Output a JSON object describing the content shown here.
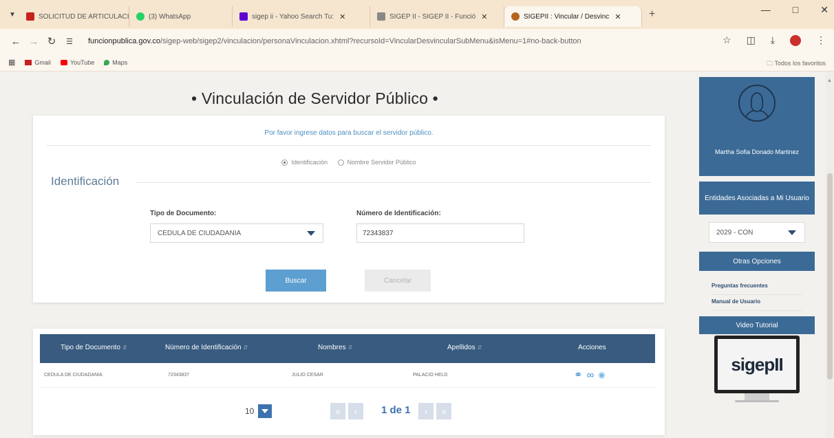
{
  "browser": {
    "tabs": [
      {
        "label": "SOLICITUD DE ARTICULACI",
        "favicon_color": "#c5221f",
        "active": false
      },
      {
        "label": "(3) WhatsApp",
        "favicon_color": "#25d366",
        "active": false
      },
      {
        "label": "sigep ii - Yahoo Search Tu:",
        "favicon_color": "#6001d2",
        "active": false
      },
      {
        "label": "SIGEP II - SIGEP II - Funció",
        "favicon_color": "#888888",
        "active": false
      },
      {
        "label": "SIGEPII : Vincular / Desvinc",
        "favicon_color": "#b5651d",
        "active": true
      }
    ],
    "url_host": "funcionpublica.gov.co",
    "url_path": "/sigep-web/sigep2/vinculacion/personaVinculacion.xhtml?recursoId=VincularDesvincularSubMenu&isMenu=1#no-back-button",
    "bookmarks": [
      {
        "label": "Gmail",
        "color": "#c5221f"
      },
      {
        "label": "YouTube",
        "color": "#ff0000"
      },
      {
        "label": "Maps",
        "color": "#34a853"
      }
    ],
    "bookmarks_right": "Todos los favoritos"
  },
  "page": {
    "title": "• Vinculación de Servidor Público •",
    "hint": "Por favor ingrese datos para buscar el servidor público.",
    "radio_options": [
      {
        "label": "Identificación",
        "selected": true
      },
      {
        "label": "Nombre Servidor Público",
        "selected": false
      }
    ],
    "section_title": "Identificación",
    "doc_type_label": "Tipo de Documento:",
    "doc_type_value": "CEDULA DE CIUDADANIA",
    "id_number_label": "Número de Identificación:",
    "id_number_value": "72343837",
    "search_button": "Buscar",
    "cancel_button": "Cancelar"
  },
  "results": {
    "columns": [
      "Tipo de Documento",
      "Número de Identificación",
      "Nombres",
      "Apellidos",
      "Acciones"
    ],
    "rows": [
      {
        "doc_type": "CEDULA DE CIUDADANIA",
        "id_number": "72343837",
        "names": "JULIO CESAR",
        "surnames": "PALACIO HELD"
      }
    ],
    "page_size": "10",
    "page_info": "1 de 1"
  },
  "sidebar": {
    "user_name": "Martha Sofia Donado Martinez",
    "entities_header": "Entidades Asociadas a Mi Usuario",
    "entity_selected": "2029 - CON",
    "other_options_header": "Otras Opciones",
    "links": [
      "Preguntas frecuentes",
      "Manual de Usuario"
    ],
    "video_header": "Video Tutorial",
    "video_logo": "sigepII"
  },
  "colors": {
    "header_blue": "#385b7f",
    "sidebar_blue": "#3b6a96",
    "primary_button": "#5e9fd1",
    "link_blue": "#4b8ec0"
  }
}
